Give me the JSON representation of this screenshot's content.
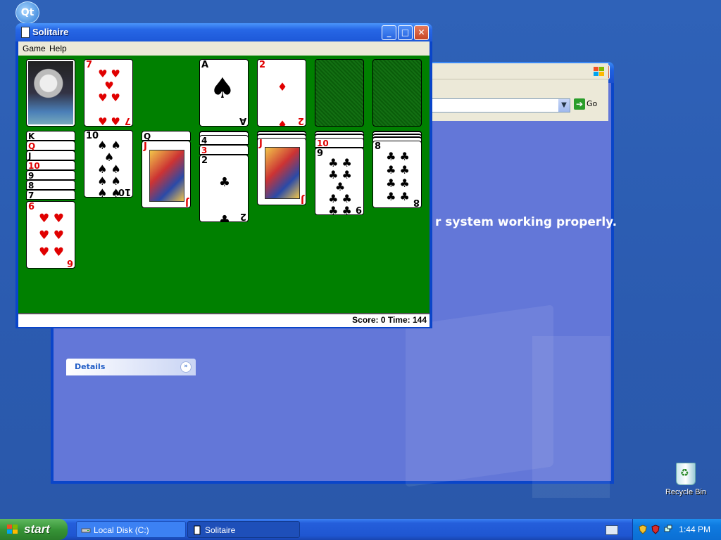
{
  "desktop": {
    "qt_icon_label": "Qt",
    "recycle_bin_label": "Recycle Bin"
  },
  "background_window": {
    "go_label": "Go",
    "headline_fragment": "r system working properly.",
    "details_label": "Details"
  },
  "solitaire": {
    "title": "Solitaire",
    "menu": [
      "Game",
      "Help"
    ],
    "status": "Score: 0 Time: 144",
    "felt_color": "#008000",
    "stock_back": "astronaut",
    "waste": {
      "rank": "7",
      "suit": "♥"
    },
    "foundations": [
      {
        "rank": "A",
        "suit": "♠"
      },
      {
        "rank": "2",
        "suit": "♦"
      },
      {
        "rank": "",
        "suit": ""
      },
      {
        "rank": "",
        "suit": ""
      }
    ],
    "tableau": [
      {
        "stacked_ranks": [
          "K",
          "Q",
          "J",
          "10",
          "9",
          "8",
          "7"
        ],
        "top": {
          "rank": "6",
          "suit": "♥"
        }
      },
      {
        "stacked_ranks": [],
        "top": {
          "rank": "10",
          "suit": "♠"
        }
      },
      {
        "stacked_ranks": [
          "Q"
        ],
        "top": {
          "rank": "J",
          "suit": "♥"
        }
      },
      {
        "stacked_ranks": [
          "4",
          "3"
        ],
        "top": {
          "rank": "2",
          "suit": "♣"
        }
      },
      {
        "stacked_ranks": [],
        "top": {
          "rank": "J",
          "suit": "♦"
        }
      },
      {
        "stacked_ranks": [
          "10"
        ],
        "top": {
          "rank": "9",
          "suit": "♣"
        }
      },
      {
        "stacked_ranks": [],
        "top": {
          "rank": "8",
          "suit": "♣"
        }
      }
    ]
  },
  "taskbar": {
    "start_label": "start",
    "buttons": [
      {
        "label": "Local Disk (C:)",
        "icon": "drive-icon"
      },
      {
        "label": "Solitaire",
        "icon": "solitaire-icon"
      }
    ],
    "clock": "1:44 PM"
  }
}
